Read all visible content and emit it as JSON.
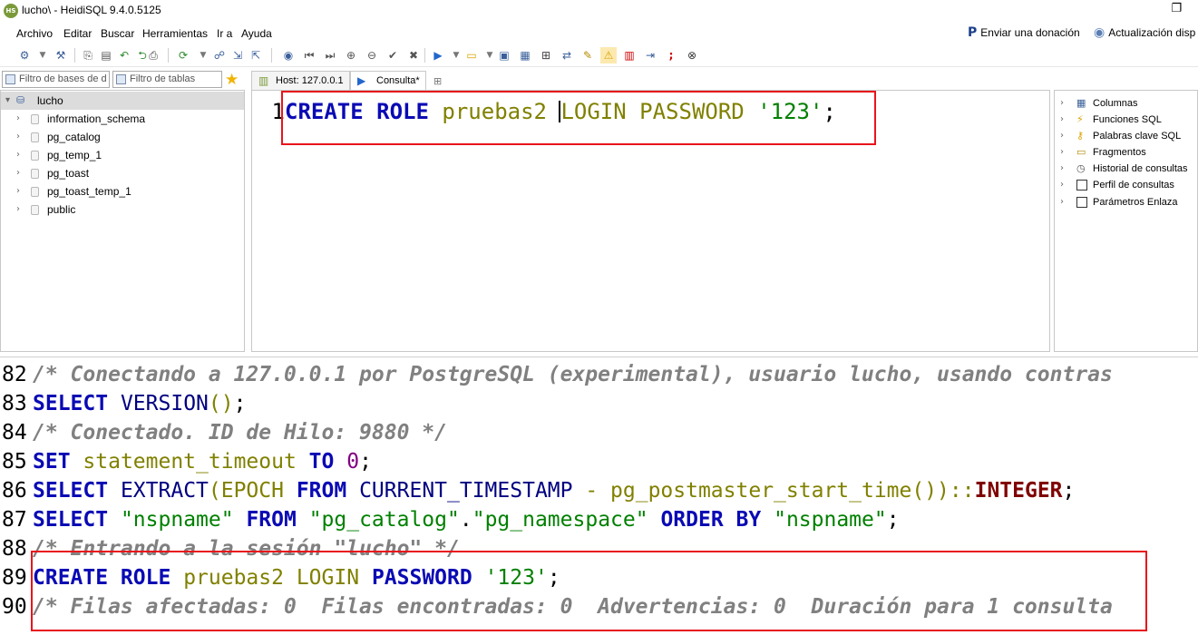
{
  "window": {
    "title": "lucho\\ - HeidiSQL 9.4.0.5125",
    "app_icon_text": "HS",
    "restore_icon": "❐"
  },
  "menu": {
    "items": [
      "Archivo",
      "Editar",
      "Buscar",
      "Herramientas",
      "Ir a",
      "Ayuda"
    ],
    "donate_label": "Enviar una donación",
    "update_label": "Actualización disp"
  },
  "toolbar": {
    "icons": [
      "connect-icon",
      "disconnect-icon",
      "copy-icon",
      "paste-icon",
      "refresh-icon",
      "print-icon",
      "reload-icon",
      "network-icon",
      "export-icon",
      "import-icon",
      "help-icon",
      "first-icon",
      "prev-icon",
      "add-icon",
      "remove-icon",
      "ok-icon",
      "cancel-icon",
      "run-icon",
      "open-icon",
      "save-icon",
      "save-as-icon",
      "table-icon",
      "search-replace-icon",
      "edit-icon",
      "warning-icon",
      "explain-icon",
      "wrap-icon",
      "semicolon-icon",
      "stop-icon"
    ]
  },
  "filters": {
    "db_placeholder": "Filtro de bases de d",
    "table_placeholder": "Filtro de tablas"
  },
  "tabs": [
    {
      "label": "Host: 127.0.0.1"
    },
    {
      "label": "Consulta*"
    }
  ],
  "tree": {
    "root": "lucho",
    "items": [
      "information_schema",
      "pg_catalog",
      "pg_temp_1",
      "pg_toast",
      "pg_toast_temp_1",
      "public"
    ]
  },
  "editor": {
    "line_number": "1",
    "tokens": {
      "kw1": "CREATE ROLE",
      "id1": "pruebas2",
      "kw2": "LOGIN PASSWORD",
      "str1": "'123'",
      "end": ";"
    }
  },
  "helper": {
    "items": [
      {
        "label": "Columnas",
        "type": "icon"
      },
      {
        "label": "Funciones SQL",
        "type": "icon"
      },
      {
        "label": "Palabras clave SQL",
        "type": "icon"
      },
      {
        "label": "Fragmentos",
        "type": "icon"
      },
      {
        "label": "Historial de consultas",
        "type": "icon"
      },
      {
        "label": "Perfil de consultas",
        "type": "check"
      },
      {
        "label": "Parámetros Enlaza",
        "type": "check"
      }
    ]
  },
  "log": {
    "lines": [
      {
        "n": "82",
        "parts": [
          [
            "cm",
            "/* Conectando a 127.0.0.1 por PostgreSQL (experimental), usuario lucho, usando contras"
          ]
        ]
      },
      {
        "n": "83",
        "parts": [
          [
            "kw",
            "SELECT"
          ],
          [
            "pun",
            " "
          ],
          [
            "fn",
            "VERSION"
          ],
          [
            "id",
            "()"
          ],
          [
            "pun",
            ";"
          ]
        ]
      },
      {
        "n": "84",
        "parts": [
          [
            "cm",
            "/* Conectado. ID de Hilo: 9880 */"
          ]
        ]
      },
      {
        "n": "85",
        "parts": [
          [
            "kw",
            "SET"
          ],
          [
            "pun",
            " "
          ],
          [
            "id",
            "statement_timeout"
          ],
          [
            "pun",
            " "
          ],
          [
            "kw",
            "TO"
          ],
          [
            "pun",
            " "
          ],
          [
            "num",
            "0"
          ],
          [
            "pun",
            ";"
          ]
        ]
      },
      {
        "n": "86",
        "parts": [
          [
            "kw",
            "SELECT"
          ],
          [
            "pun",
            " "
          ],
          [
            "fn",
            "EXTRACT"
          ],
          [
            "id",
            "(EPOCH "
          ],
          [
            "kw",
            "FROM"
          ],
          [
            "pun",
            " "
          ],
          [
            "fn",
            "CURRENT_TIMESTAMP"
          ],
          [
            "id",
            " - pg_postmaster_start_time())::"
          ],
          [
            "typ",
            "INTEGER"
          ],
          [
            "pun",
            ";"
          ]
        ]
      },
      {
        "n": "87",
        "parts": [
          [
            "kw",
            "SELECT"
          ],
          [
            "pun",
            " "
          ],
          [
            "dq",
            "\"nspname\""
          ],
          [
            "pun",
            " "
          ],
          [
            "kw",
            "FROM"
          ],
          [
            "pun",
            " "
          ],
          [
            "dq",
            "\"pg_catalog\""
          ],
          [
            "pun",
            "."
          ],
          [
            "dq",
            "\"pg_namespace\""
          ],
          [
            "pun",
            " "
          ],
          [
            "kw",
            "ORDER BY"
          ],
          [
            "pun",
            " "
          ],
          [
            "dq",
            "\"nspname\""
          ],
          [
            "pun",
            ";"
          ]
        ]
      },
      {
        "n": "88",
        "parts": [
          [
            "cm",
            "/* Entrando a la sesión \"lucho\" */"
          ]
        ]
      },
      {
        "n": "89",
        "parts": [
          [
            "kw",
            "CREATE ROLE"
          ],
          [
            "pun",
            " "
          ],
          [
            "id",
            "pruebas2"
          ],
          [
            "pun",
            " "
          ],
          [
            "id",
            "LOGIN"
          ],
          [
            "pun",
            " "
          ],
          [
            "kw",
            "PASSWORD"
          ],
          [
            "pun",
            " "
          ],
          [
            "str",
            "'123'"
          ],
          [
            "pun",
            ";"
          ]
        ]
      },
      {
        "n": "90",
        "parts": [
          [
            "cm",
            "/* Filas afectadas: 0  Filas encontradas: 0  Advertencias: 0  Duración para 1 consulta"
          ]
        ]
      }
    ]
  },
  "colors": {
    "highlight": "#e8141b",
    "keyword": "#0a0ab4",
    "identifier": "#808000",
    "string": "#008000",
    "comment": "#808080"
  }
}
